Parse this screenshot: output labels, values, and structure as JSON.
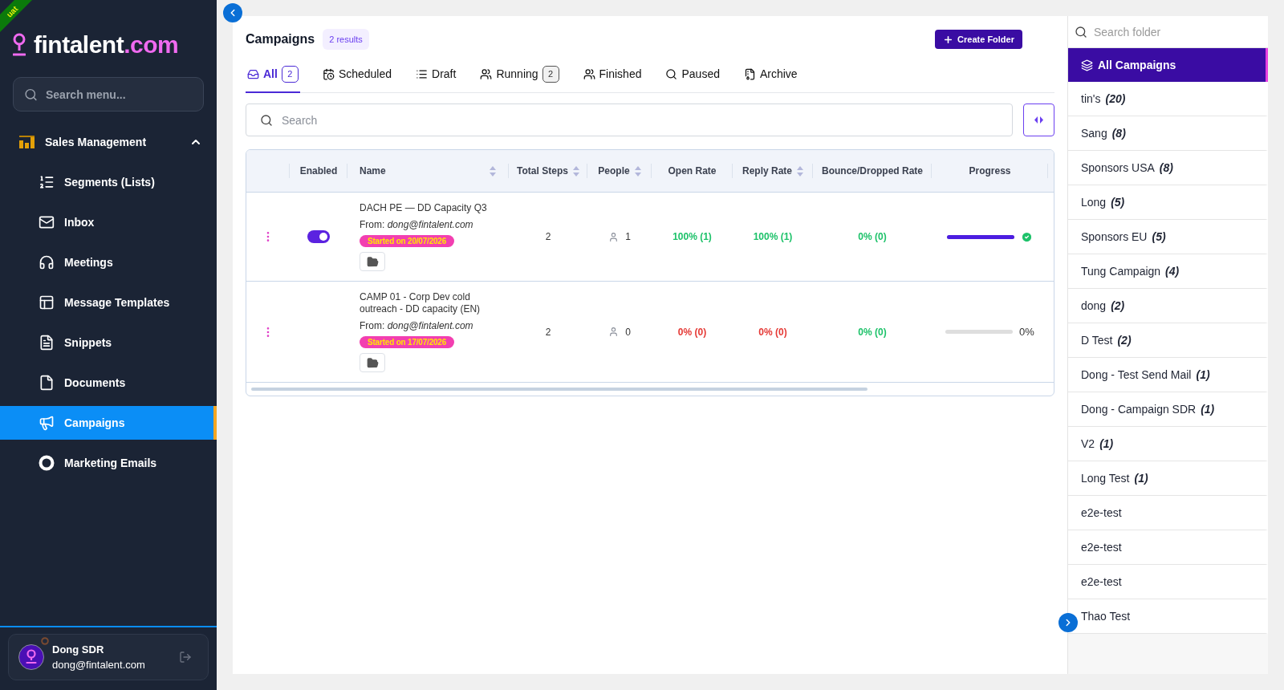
{
  "environment": "uat",
  "logo": {
    "name": "fintalent",
    "suffix": ".com"
  },
  "sidebar": {
    "search": {
      "placeholder": "Search menu..."
    },
    "groups": [
      {
        "label": "Sales Management",
        "expanded": true,
        "items": [
          {
            "label": "Segments (Lists)",
            "selected": false
          },
          {
            "label": "Inbox",
            "selected": false
          },
          {
            "label": "Meetings",
            "selected": false
          },
          {
            "label": "Message Templates",
            "selected": false
          },
          {
            "label": "Snippets",
            "selected": false
          },
          {
            "label": "Documents",
            "selected": false
          },
          {
            "label": "Campaigns",
            "selected": true
          },
          {
            "label": "Marketing Emails",
            "selected": false
          }
        ]
      }
    ]
  },
  "user": {
    "name": "Dong SDR",
    "email": "dong@fintalent.com"
  },
  "page": {
    "title": "Campaigns",
    "result_count": "2 results",
    "create_button": "Create Folder"
  },
  "tabs": [
    {
      "label": "All",
      "count": "2",
      "selected": true
    },
    {
      "label": "Scheduled",
      "selected": false
    },
    {
      "label": "Draft",
      "selected": false
    },
    {
      "label": "Running",
      "count": "2",
      "selected": false
    },
    {
      "label": "Finished",
      "selected": false
    },
    {
      "label": "Paused",
      "selected": false
    },
    {
      "label": "Archive",
      "selected": false
    }
  ],
  "search": {
    "placeholder": "Search"
  },
  "table": {
    "columns": [
      {
        "label": "Enabled",
        "sortable": false
      },
      {
        "label": "Name",
        "sortable": true
      },
      {
        "label": "Total Steps",
        "sortable": true
      },
      {
        "label": "People",
        "sortable": true
      },
      {
        "label": "Open Rate",
        "sortable": false
      },
      {
        "label": "Reply Rate",
        "sortable": true
      },
      {
        "label": "Bounce/Dropped Rate",
        "sortable": false
      },
      {
        "label": "Progress",
        "sortable": false
      }
    ],
    "rows": [
      {
        "enabled": true,
        "name": "DACH PE — DD Capacity Q3",
        "from": "From: *dong@fintalent.com*",
        "started": "Started on 20/07/2026",
        "total_steps": "2",
        "people": "1",
        "open_rate": {
          "text": "100% (1)",
          "color": "#1ec26a"
        },
        "reply_rate": {
          "text": "100% (1)",
          "color": "#1ec26a"
        },
        "bounce_rate": {
          "text": "0% (0)",
          "color": "#1ec26a"
        },
        "progress": {
          "level": 1,
          "complete": true
        }
      },
      {
        "name": "CAMP 01 - Corp Dev cold outreach - DD capacity (EN)",
        "from": "From: *dong@fintalent.com*",
        "started": "Started on 17/07/2026",
        "total_steps": "2",
        "people": "0",
        "open_rate": {
          "text": "0% (0)",
          "color": "#e53935"
        },
        "reply_rate": {
          "text": "0% (0)",
          "color": "#e53935"
        },
        "bounce_rate": {
          "text": "0% (0)",
          "color": "#1ec26a"
        },
        "progress": {
          "level": 0,
          "complete": false,
          "reading": "0%"
        }
      }
    ]
  },
  "folders": {
    "search": {
      "placeholder": "Search folder"
    },
    "items": [
      {
        "kind": "all",
        "label": "All Campaigns",
        "selected": true
      },
      {
        "kind": "folder",
        "label": "tin's",
        "count": "(20)",
        "selected": false
      },
      {
        "kind": "folder",
        "label": "Sang",
        "count": "(8)",
        "selected": false
      },
      {
        "kind": "folder",
        "label": "Sponsors USA",
        "count": "(8)",
        "selected": false
      },
      {
        "kind": "folder",
        "label": "Long",
        "count": "(5)",
        "selected": false
      },
      {
        "kind": "folder",
        "label": "Sponsors EU",
        "count": "(5)",
        "selected": false
      },
      {
        "kind": "folder",
        "label": "Tung Campaign",
        "count": "(4)",
        "selected": false
      },
      {
        "kind": "folder",
        "label": "dong",
        "count": "(2)",
        "selected": false
      },
      {
        "kind": "folder",
        "label": "D Test",
        "count": "(2)",
        "selected": false
      },
      {
        "kind": "folder",
        "label": "Dong - Test Send Mail",
        "count": "(1)",
        "selected": false
      },
      {
        "kind": "folder",
        "label": "Dong - Campaign SDR",
        "count": "(1)",
        "selected": false
      },
      {
        "kind": "folder",
        "label": "V2",
        "count": "(1)",
        "selected": false
      },
      {
        "kind": "folder",
        "label": "Long Test",
        "count": "(1)",
        "selected": false
      },
      {
        "kind": "folder",
        "label": "e2e-test",
        "selected": false
      },
      {
        "kind": "folder",
        "label": "e2e-test",
        "selected": false
      },
      {
        "kind": "folder",
        "label": "e2e-test",
        "selected": false
      },
      {
        "kind": "folder",
        "label": "Thao Test",
        "selected": false
      }
    ]
  }
}
